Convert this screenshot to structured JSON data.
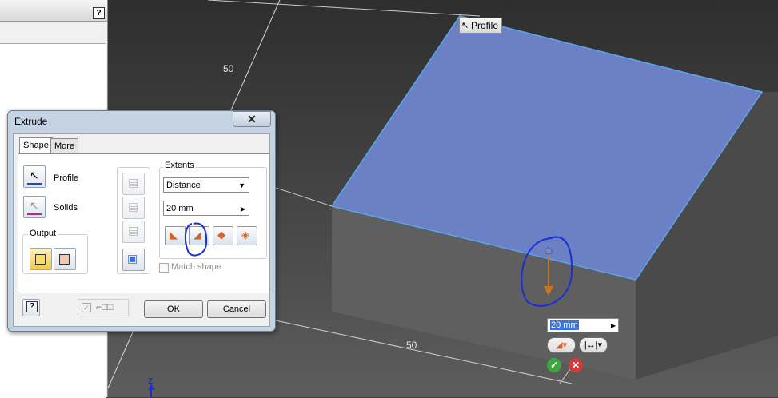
{
  "viewport": {
    "dimension_top": "50",
    "dimension_bottom": "50",
    "axis_label": "Z",
    "profile_tooltip": "Profile",
    "face_color": "#6b80c5",
    "edge_color": "#5aa8e8",
    "annotation_color": "#1a2fd6"
  },
  "dialog": {
    "title": "Extrude",
    "close_glyph": "✕",
    "tabs": [
      "Shape",
      "More"
    ],
    "profile_label": "Profile",
    "solids_label": "Solids",
    "output_label": "Output",
    "extents_label": "Extents",
    "extents_value": "Distance",
    "distance_value": "20 mm",
    "match_shape_label": "Match shape",
    "ok_label": "OK",
    "cancel_label": "Cancel",
    "help_glyph": "?"
  },
  "mini_toolbar": {
    "distance_value": "20 mm"
  }
}
